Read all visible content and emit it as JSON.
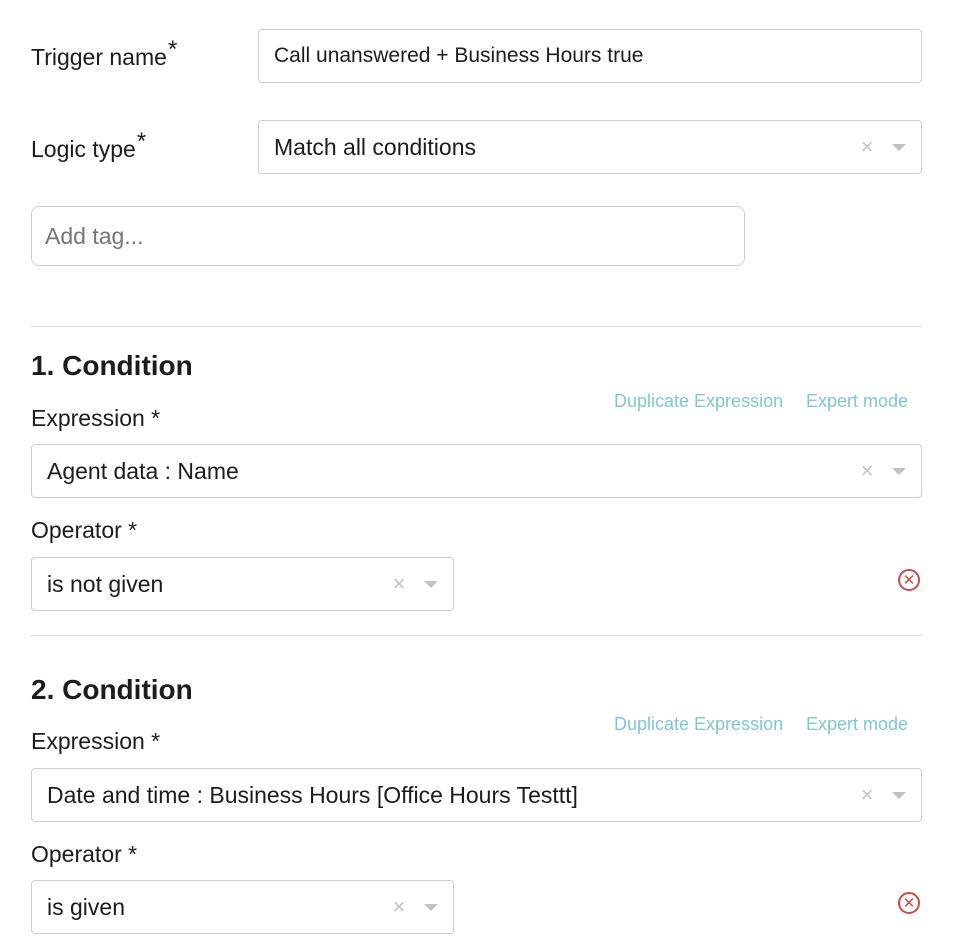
{
  "trigger": {
    "label": "Trigger name",
    "required_mark": "*",
    "value": "Call unanswered + Business Hours true"
  },
  "logic": {
    "label": "Logic type",
    "required_mark": "*",
    "value": "Match all conditions"
  },
  "tags": {
    "placeholder": "Add tag..."
  },
  "icons": {
    "clear": "×",
    "remove": "✕",
    "caret": "chevron-down-icon"
  },
  "colors": {
    "link": "#7fc8cc",
    "remove": "#c84c4c"
  },
  "conditions": [
    {
      "title": "1. Condition",
      "duplicate": "Duplicate Expression",
      "expert": "Expert mode",
      "expression_label": "Expression *",
      "expression_value": "Agent data : Name",
      "operator_label": "Operator *",
      "operator_value": "is not given"
    },
    {
      "title": "2. Condition",
      "duplicate": "Duplicate Expression",
      "expert": "Expert mode",
      "expression_label": "Expression *",
      "expression_value": "Date and time : Business Hours [Office Hours Testtt]",
      "operator_label": "Operator *",
      "operator_value": "is given"
    }
  ]
}
